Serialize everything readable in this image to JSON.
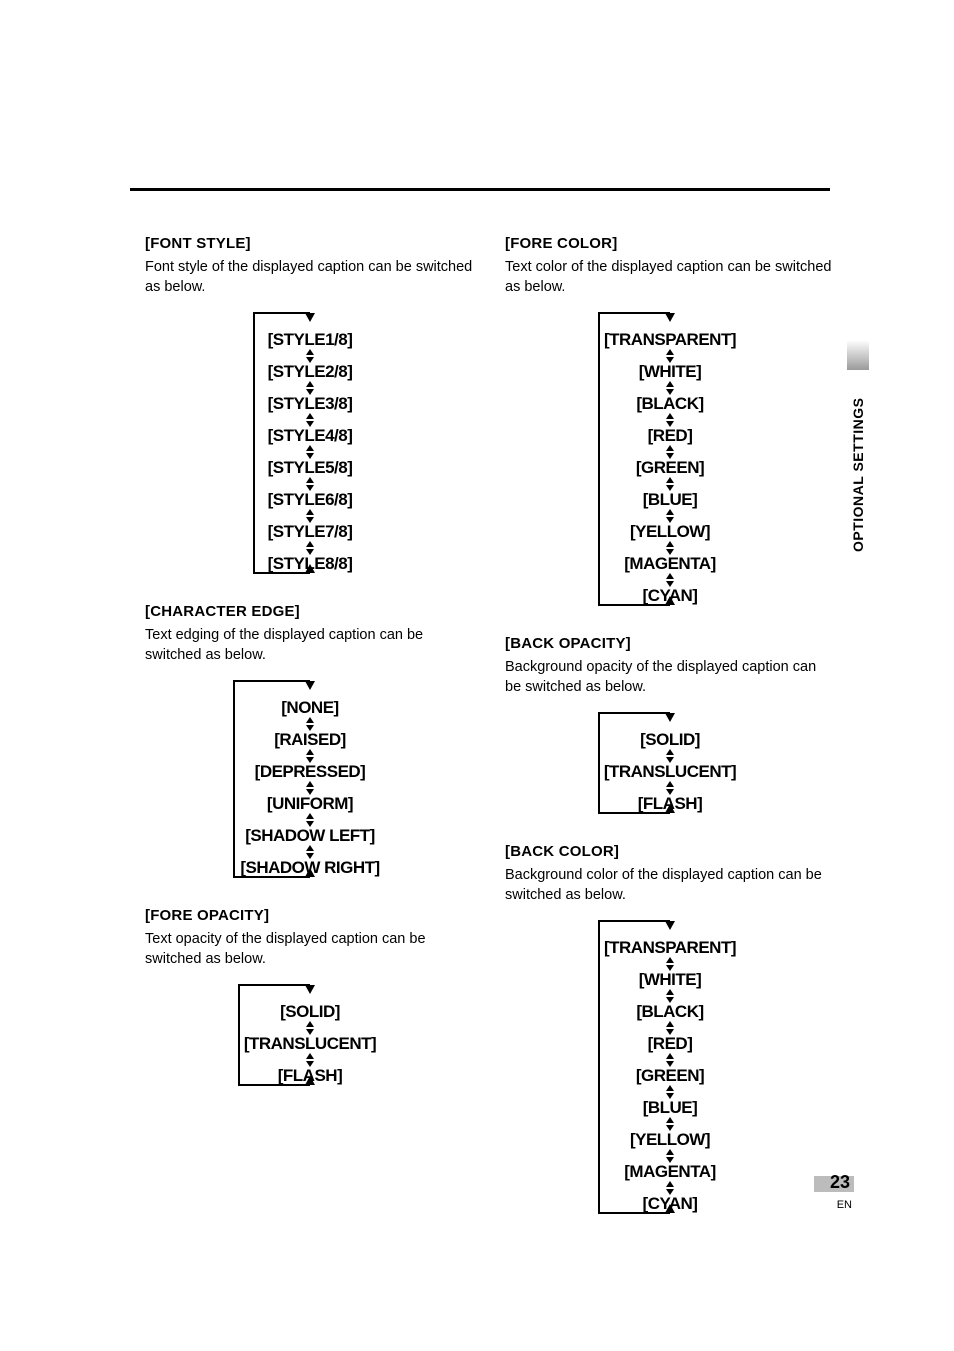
{
  "sidebar": "OPTIONAL SETTINGS",
  "page_number": "23",
  "lang": "EN",
  "left": [
    {
      "heading": "[FONT STYLE]",
      "desc": "Font style of the displayed caption can be switched as below.",
      "items": [
        "[STYLE1/8]",
        "[STYLE2/8]",
        "[STYLE3/8]",
        "[STYLE4/8]",
        "[STYLE5/8]",
        "[STYLE6/8]",
        "[STYLE7/8]",
        "[STYLE8/8]"
      ]
    },
    {
      "heading": "[CHARACTER EDGE]",
      "desc": "Text edging of the displayed caption can be switched as below.",
      "items": [
        "[NONE]",
        "[RAISED]",
        "[DEPRESSED]",
        "[UNIFORM]",
        "[SHADOW LEFT]",
        "[SHADOW RIGHT]"
      ]
    },
    {
      "heading": "[FORE OPACITY]",
      "desc": "Text opacity of the displayed caption can be switched as below.",
      "items": [
        "[SOLID]",
        "[TRANSLUCENT]",
        "[FLASH]"
      ]
    }
  ],
  "right": [
    {
      "heading": "[FORE COLOR]",
      "desc": "Text color of the displayed caption can be switched as below.",
      "items": [
        "[TRANSPARENT]",
        "[WHITE]",
        "[BLACK]",
        "[RED]",
        "[GREEN]",
        "[BLUE]",
        "[YELLOW]",
        "[MAGENTA]",
        "[CYAN]"
      ]
    },
    {
      "heading": "[BACK OPACITY]",
      "desc": "Background opacity of the displayed caption can be switched as below.",
      "items": [
        "[SOLID]",
        "[TRANSLUCENT]",
        "[FLASH]"
      ]
    },
    {
      "heading": "[BACK COLOR]",
      "desc": "Background color of the displayed caption can be switched as below.",
      "items": [
        "[TRANSPARENT]",
        "[WHITE]",
        "[BLACK]",
        "[RED]",
        "[GREEN]",
        "[BLUE]",
        "[YELLOW]",
        "[MAGENTA]",
        "[CYAN]"
      ]
    }
  ]
}
